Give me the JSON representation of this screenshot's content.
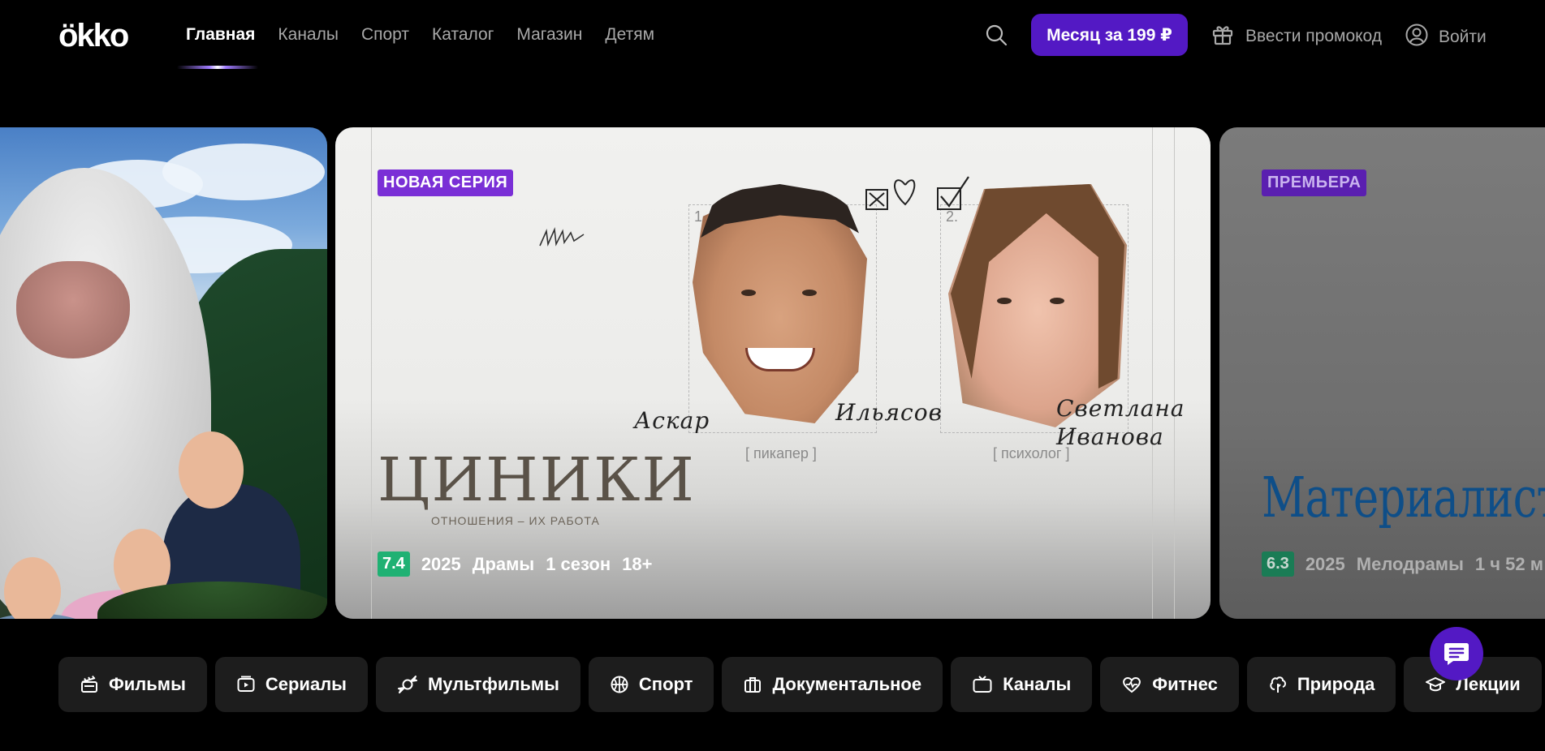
{
  "header": {
    "logo": "ökko",
    "nav": [
      "Главная",
      "Каналы",
      "Спорт",
      "Каталог",
      "Магазин",
      "Детям"
    ],
    "subscribe_label": "Месяц за 199 ₽",
    "promo_label": "Ввести промокод",
    "login_label": "Войти"
  },
  "hero": {
    "main": {
      "badge": "НОВАЯ СЕРИЯ",
      "title": "ЦИНИКИ",
      "tagline": "ОТНОШЕНИЯ – ИХ РАБОТА",
      "rating": "7.4",
      "year": "2025",
      "genre": "Драмы",
      "seasons": "1 сезон",
      "age": "18+",
      "person1_num": "1.",
      "person2_num": "2.",
      "person1_first": "Аскар",
      "person1_last": "Ильясов",
      "person1_role": "[ пикапер ]",
      "person2_first": "Светлана",
      "person2_last": "Иванова",
      "person2_role": "[ психолог ]"
    },
    "next": {
      "badge": "ПРЕМЬЕРА",
      "title": "Материалистка",
      "rating": "6.3",
      "year": "2025",
      "genre": "Мелодрамы",
      "duration": "1 ч 52 м"
    }
  },
  "categories": [
    "Фильмы",
    "Сериалы",
    "Мультфильмы",
    "Спорт",
    "Документальное",
    "Каналы",
    "Фитнес",
    "Природа",
    "Лекции"
  ],
  "colors": {
    "accent": "#5319c4",
    "badge": "#7a2fd6",
    "rating_green": "#1fb173"
  }
}
